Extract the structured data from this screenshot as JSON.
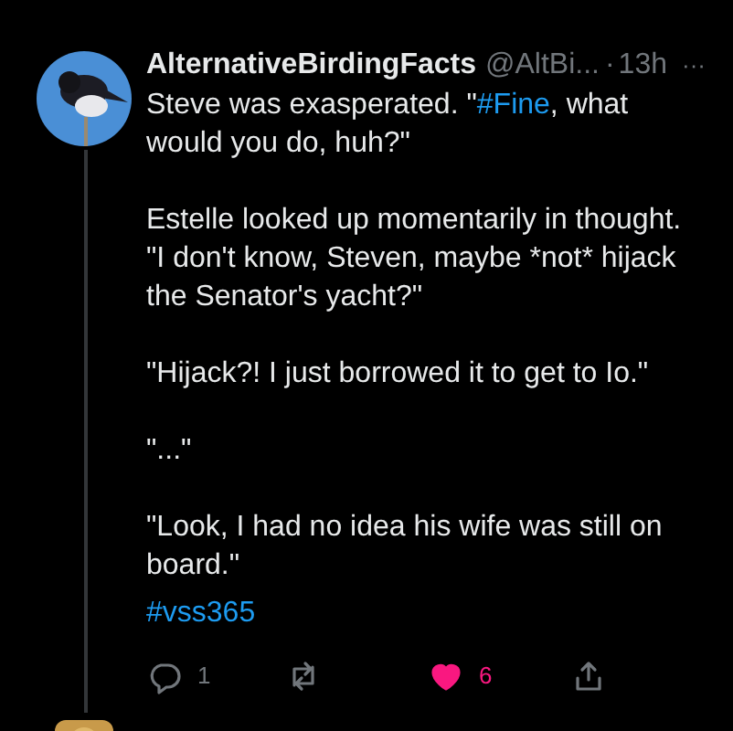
{
  "tweet": {
    "display_name": "AlternativeBirdingFacts",
    "handle": "@AltBi...",
    "separator": "·",
    "time": "13h",
    "more": "···",
    "paragraphs": [
      [
        {
          "kind": "text",
          "text": "Steve was exasperated. \""
        },
        {
          "kind": "hashtag",
          "text": "#Fine"
        },
        {
          "kind": "text",
          "text": ", what would you do, huh?\""
        }
      ],
      [
        {
          "kind": "text",
          "text": "Estelle looked up momentarily in thought. \"I don't know, Steven, maybe *not* hijack the Senator's yacht?\""
        }
      ],
      [
        {
          "kind": "text",
          "text": "\"Hijack?! I just borrowed it to get to Io.\""
        }
      ],
      [
        {
          "kind": "text",
          "text": "\"...\""
        }
      ],
      [
        {
          "kind": "text",
          "text": "\"Look, I had no idea his wife was still on board.\""
        }
      ],
      [
        {
          "kind": "hashtag",
          "text": "#vss365"
        }
      ]
    ],
    "actions": [
      {
        "kind": "reply",
        "count": "1",
        "active": false
      },
      {
        "kind": "retweet",
        "active": false
      },
      {
        "kind": "like",
        "count": "6",
        "active": true
      },
      {
        "kind": "share",
        "active": false
      }
    ]
  }
}
